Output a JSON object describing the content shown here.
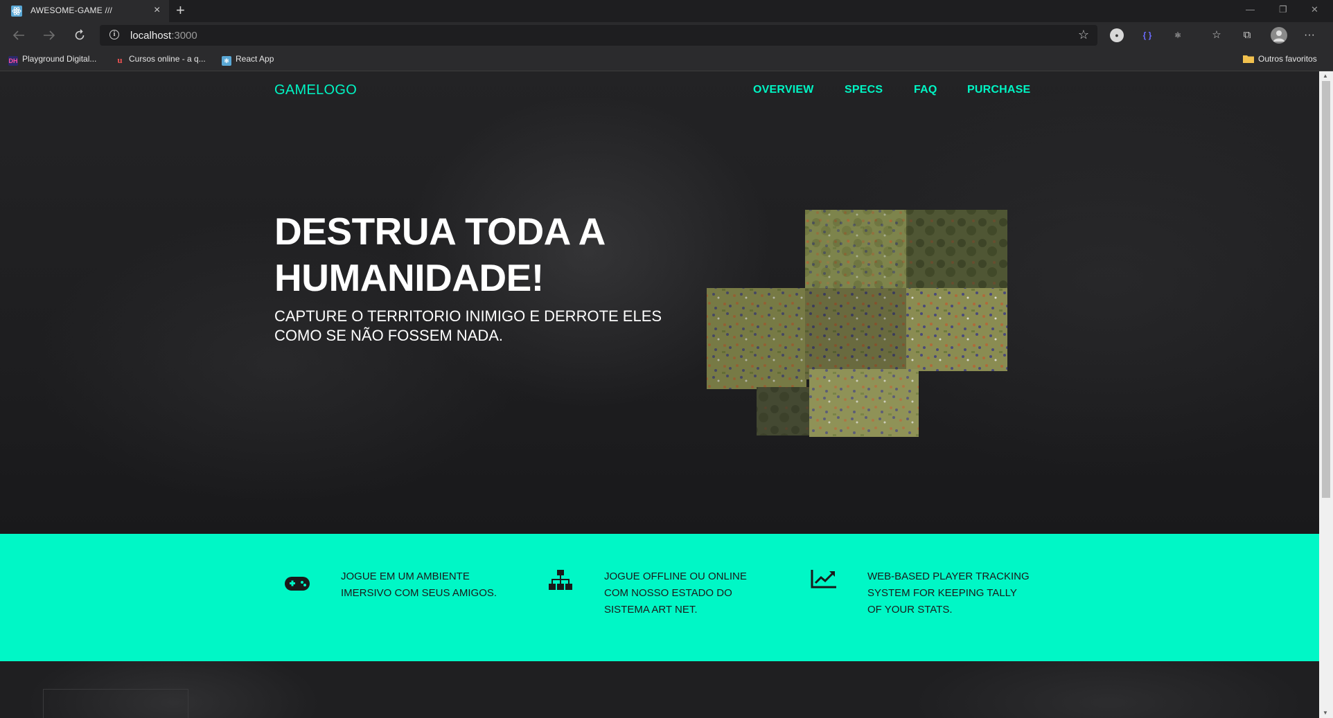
{
  "browser": {
    "tab_title": "AWESOME-GAME ///",
    "tab_close": "×",
    "new_tab": "+",
    "window_controls": [
      "—",
      "❐",
      "✕"
    ],
    "url_host": "localhost",
    "url_port": ":3000",
    "more": "···",
    "bookmarks": [
      {
        "label": "Playground Digital...",
        "icon": "dh-icon"
      },
      {
        "label": "Cursos online - a q...",
        "icon": "udemy-icon"
      },
      {
        "label": "React App",
        "icon": "react-icon"
      }
    ],
    "other_favorites": "Outros favoritos"
  },
  "nav": {
    "logo": "GAMELOGO",
    "links": [
      "OVERVIEW",
      "SPECS",
      "FAQ",
      "PURCHASE"
    ]
  },
  "hero": {
    "headline": "DESTRUA TODA A HUMANIDADE!",
    "subline": "CAPTURE O TERRITORIO INIMIGO E DERROTE ELES COMO SE NÃO FOSSEM NADA."
  },
  "features": [
    {
      "icon": "gamepad-icon",
      "text": "JOGUE EM UM AMBIENTE IMERSIVO COM SEUS AMIGOS."
    },
    {
      "icon": "sitemap-icon",
      "text": "JOGUE OFFLINE OU ONLINE COM NOSSO ESTADO DO SISTEMA ART NET."
    },
    {
      "icon": "chart-line-icon",
      "text": "WEB-BASED PLAYER TRACKING SYSTEM FOR KEEPING TALLY OF YOUR STATS."
    }
  ],
  "colors": {
    "accent": "#00f5c4",
    "feature_band": "#00f7c6",
    "background": "#1c1c1e"
  }
}
